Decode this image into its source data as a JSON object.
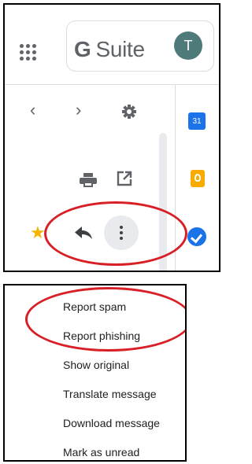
{
  "header": {
    "brand_letter": "G",
    "brand_name": "Suite",
    "avatar_initial": "T"
  },
  "toolbar": {
    "prev_glyph": "‹",
    "next_glyph": "›",
    "star_glyph": "★"
  },
  "side_apps": {
    "calendar_label": "31"
  },
  "menu": {
    "items": [
      {
        "label": "Report spam"
      },
      {
        "label": "Report phishing"
      },
      {
        "label": "Show original"
      },
      {
        "label": "Translate message"
      },
      {
        "label": "Download message"
      },
      {
        "label": "Mark as unread"
      }
    ]
  },
  "colors": {
    "highlight": "#d91f26",
    "accent": "#1a73e8",
    "star": "#f4b400"
  }
}
